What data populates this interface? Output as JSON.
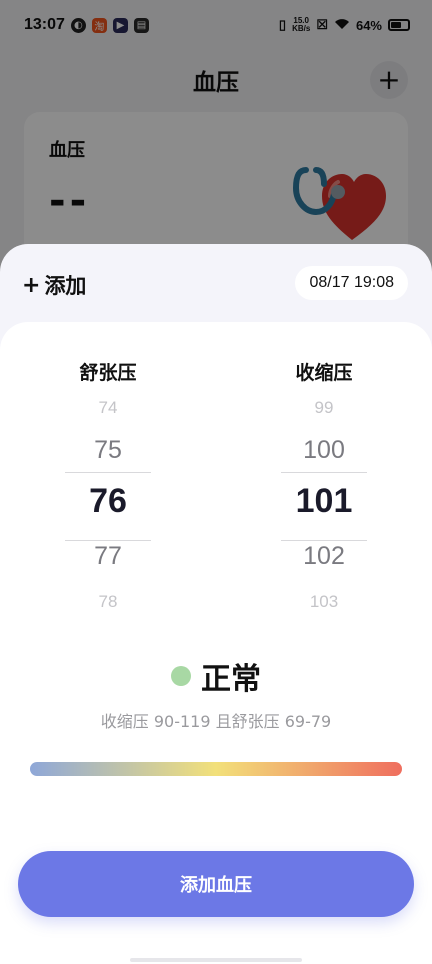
{
  "status_bar": {
    "time": "13:07",
    "net_speed_value": "15.0",
    "net_speed_unit": "KB/s",
    "battery": "64%",
    "battery_level": 0.64
  },
  "header": {
    "title": "血压",
    "add_icon": "plus-icon"
  },
  "bp_card": {
    "title": "血压",
    "value": "--",
    "sub": "..."
  },
  "sheet": {
    "add_label": "添加",
    "datetime": "08/17 19:08",
    "pickers": [
      {
        "label": "舒张压",
        "values": [
          "74",
          "75",
          "76",
          "77",
          "78"
        ],
        "selected": "76"
      },
      {
        "label": "收缩压",
        "values": [
          "99",
          "100",
          "101",
          "102",
          "103"
        ],
        "selected": "101"
      }
    ],
    "status": {
      "label": "正常",
      "color": "#a8d8a4"
    },
    "range_text": "收缩压 90-119 且舒张压 69-79",
    "gradient_colors": [
      "#8ea7d8",
      "#f2e07a",
      "#ef6e5e"
    ],
    "submit_label": "添加血压",
    "accent_color": "#6c78e6"
  }
}
